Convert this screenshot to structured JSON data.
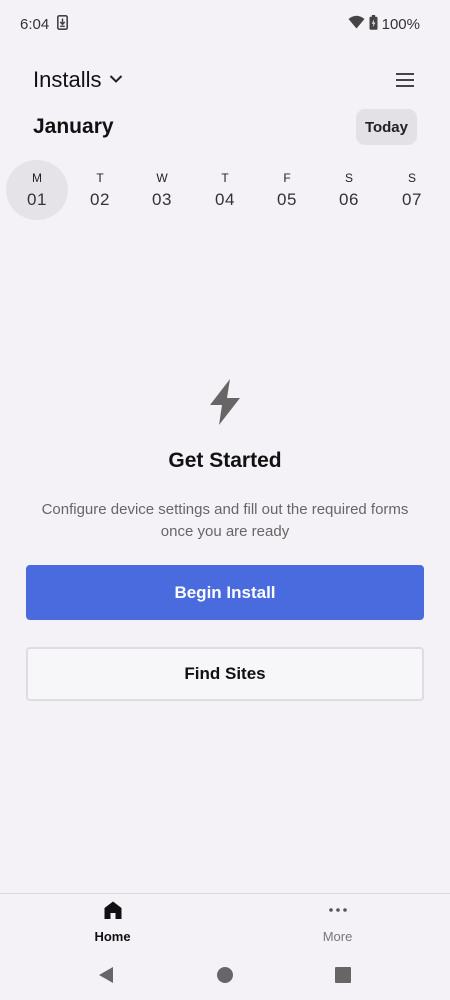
{
  "status_bar": {
    "time": "6:04",
    "battery_percent": "100%",
    "icons": [
      "download-icon",
      "wifi-icon",
      "battery-icon"
    ]
  },
  "header": {
    "title": "Installs",
    "title_icon": "chevron-down-icon",
    "menu_icon": "menu-icon"
  },
  "calendar": {
    "month": "January",
    "today_label": "Today",
    "days": [
      {
        "letter": "M",
        "number": "01",
        "selected": true
      },
      {
        "letter": "T",
        "number": "02",
        "selected": false
      },
      {
        "letter": "W",
        "number": "03",
        "selected": false
      },
      {
        "letter": "T",
        "number": "04",
        "selected": false
      },
      {
        "letter": "F",
        "number": "05",
        "selected": false
      },
      {
        "letter": "S",
        "number": "06",
        "selected": false
      },
      {
        "letter": "S",
        "number": "07",
        "selected": false
      }
    ]
  },
  "empty_state": {
    "icon": "lightning-bolt-icon",
    "title": "Get Started",
    "description": "Configure device settings and fill out the required forms once you are ready"
  },
  "actions": {
    "primary_label": "Begin Install",
    "secondary_label": "Find Sites"
  },
  "bottom_nav": {
    "items": [
      {
        "label": "Home",
        "icon": "home-icon",
        "active": true
      },
      {
        "label": "More",
        "icon": "more-dots-icon",
        "active": false
      }
    ]
  },
  "system_nav": {
    "icons": [
      "back-icon",
      "home-circle-icon",
      "recents-icon"
    ]
  },
  "colors": {
    "background": "#f4f2f6",
    "primary": "#4a6bdd",
    "selected_day": "#e5e3e7"
  }
}
